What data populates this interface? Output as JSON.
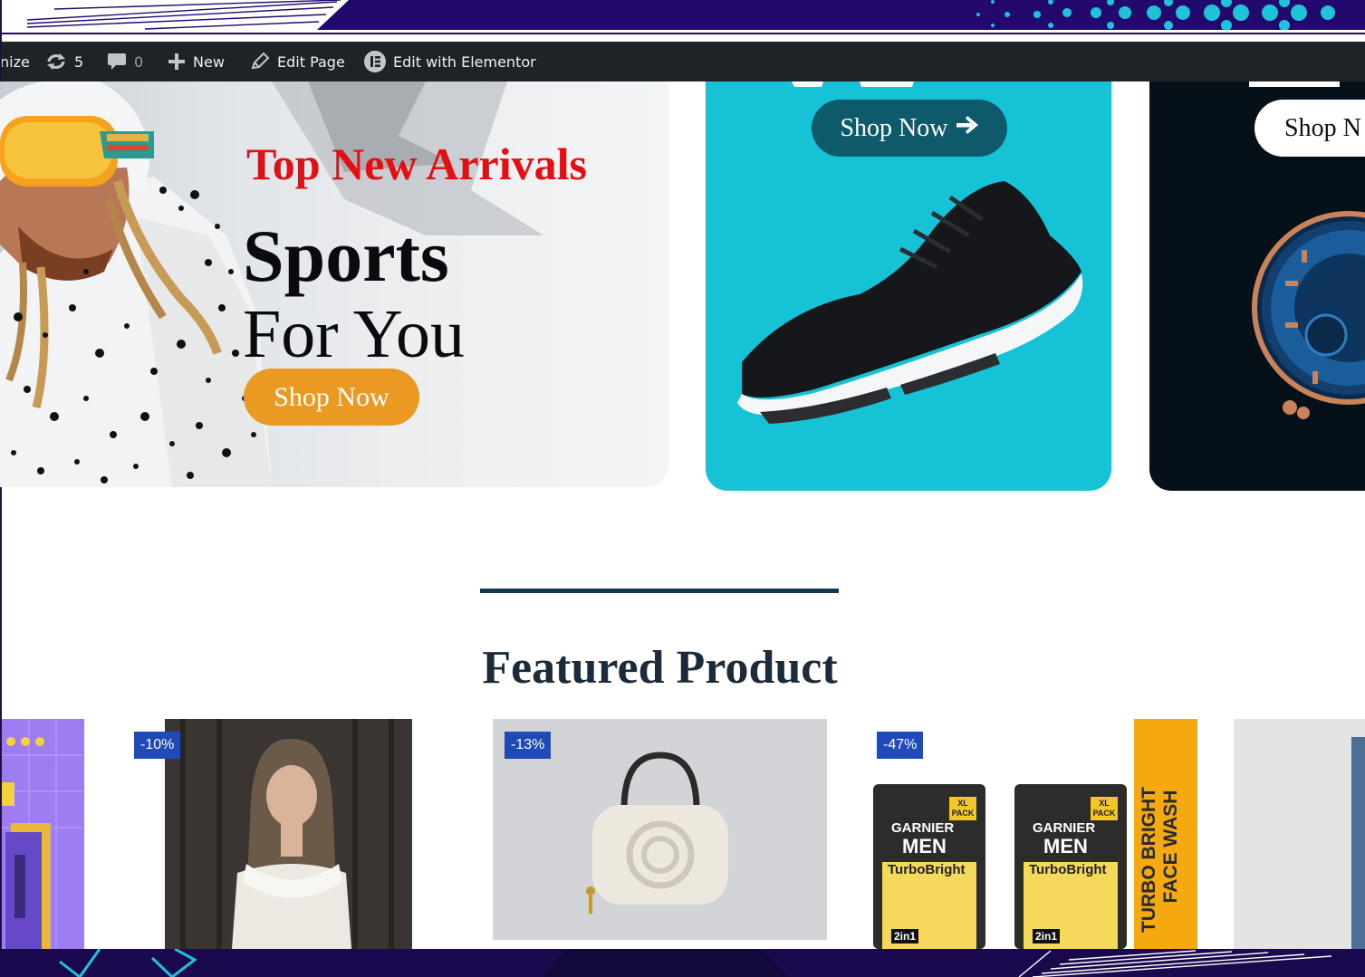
{
  "admin_bar": {
    "customize_label": "nize",
    "updates_count": "5",
    "comments_count": "0",
    "new_label": "New",
    "edit_page_label": "Edit Page",
    "edit_elementor_label": "Edit with Elementor"
  },
  "hero": {
    "card1": {
      "kicker": "Top New Arrivals",
      "title": "Sports",
      "subtitle": "For You",
      "button": "Shop Now"
    },
    "card2": {
      "button": "Shop Now"
    },
    "card3": {
      "button": "Shop N"
    }
  },
  "featured": {
    "title": "Featured Product",
    "products": [
      {
        "badge": "-10%"
      },
      {
        "badge": "-13%"
      },
      {
        "badge": "-47%",
        "brand": "GARNIER",
        "line": "MEN",
        "product_name": "TurboBright",
        "side_text_1": "TURBO BRIGHT",
        "side_text_2": "FACE WASH",
        "pack_label": "XL PACK",
        "two_in_one": "2in1"
      }
    ]
  },
  "colors": {
    "band": "#23096e",
    "admin_bar": "#1d2327",
    "accent_red": "#e40f12",
    "accent_orange": "#ea9a22",
    "teal_button": "#0e5a6b",
    "badge": "#1f4ab8",
    "divider": "#0f3a52"
  },
  "icons": [
    "refresh-icon",
    "comment-icon",
    "plus-icon",
    "pencil-icon",
    "elementor-icon",
    "arrow-right-icon"
  ]
}
